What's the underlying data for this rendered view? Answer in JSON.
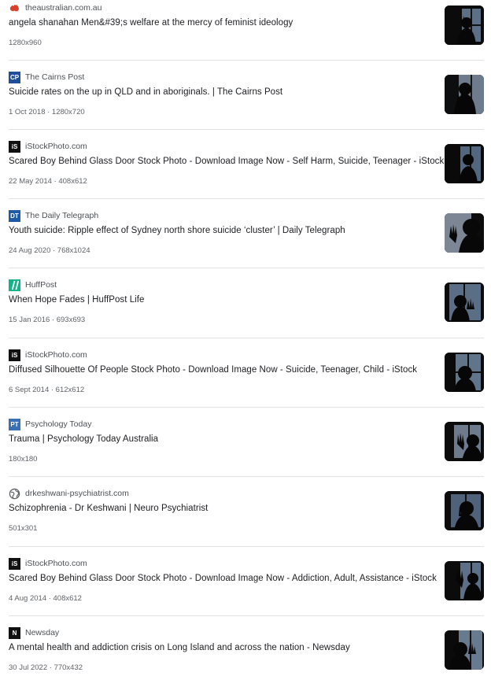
{
  "results": [
    {
      "source": "theaustralian.com.au",
      "icon": "australia-map-icon",
      "title": "angela shanahan Men&#39;s welfare at the mercy of feminist ideology",
      "meta": "1280x960"
    },
    {
      "source": "The Cairns Post",
      "icon": "cp-logo-icon",
      "icon_text": "CP",
      "title": "Suicide rates on the up in QLD and in aboriginals. | The Cairns Post",
      "meta": "1 Oct 2018 · 1280x720"
    },
    {
      "source": "iStockPhoto.com",
      "icon": "istock-logo-icon",
      "icon_text": "iS",
      "title": "Scared Boy Behind Glass Door Stock Photo - Download Image Now - Self Harm, Suicide, Teenager - iStock",
      "meta": "22 May 2014 · 408x612"
    },
    {
      "source": "The Daily Telegraph",
      "icon": "dt-logo-icon",
      "icon_text": "DT",
      "title": "Youth suicide: Ripple effect of Sydney north shore suicide ‘cluster’ | Daily Telegraph",
      "meta": "24 Aug 2020 · 768x1024"
    },
    {
      "source": "HuffPost",
      "icon": "huffpost-logo-icon",
      "title": "When Hope Fades | HuffPost Life",
      "meta": "15 Jan 2016 · 693x693"
    },
    {
      "source": "iStockPhoto.com",
      "icon": "istock-logo-icon",
      "icon_text": "iS",
      "title": "Diffused Silhouette Of People Stock Photo - Download Image Now - Suicide, Teenager, Child - iStock",
      "meta": "6 Sept 2014 · 612x612"
    },
    {
      "source": "Psychology Today",
      "icon": "pt-logo-icon",
      "icon_text": "PT",
      "title": "Trauma | Psychology Today Australia",
      "meta": "180x180"
    },
    {
      "source": "drkeshwani-psychiatrist.com",
      "icon": "globe-icon",
      "title": "Schizophrenia - Dr Keshwani | Neuro Psychiatrist",
      "meta": "501x301"
    },
    {
      "source": "iStockPhoto.com",
      "icon": "istock-logo-icon",
      "icon_text": "iS",
      "title": "Scared Boy Behind Glass Door Stock Photo - Download Image Now - Addiction, Adult, Assistance - iStock",
      "meta": "4 Aug 2014 · 408x612"
    },
    {
      "source": "Newsday",
      "icon": "newsday-logo-icon",
      "icon_text": "N",
      "title": "A mental health and addiction crisis on Long Island and across the nation - Newsday",
      "meta": "30 Jul 2022 · 770x432"
    }
  ]
}
